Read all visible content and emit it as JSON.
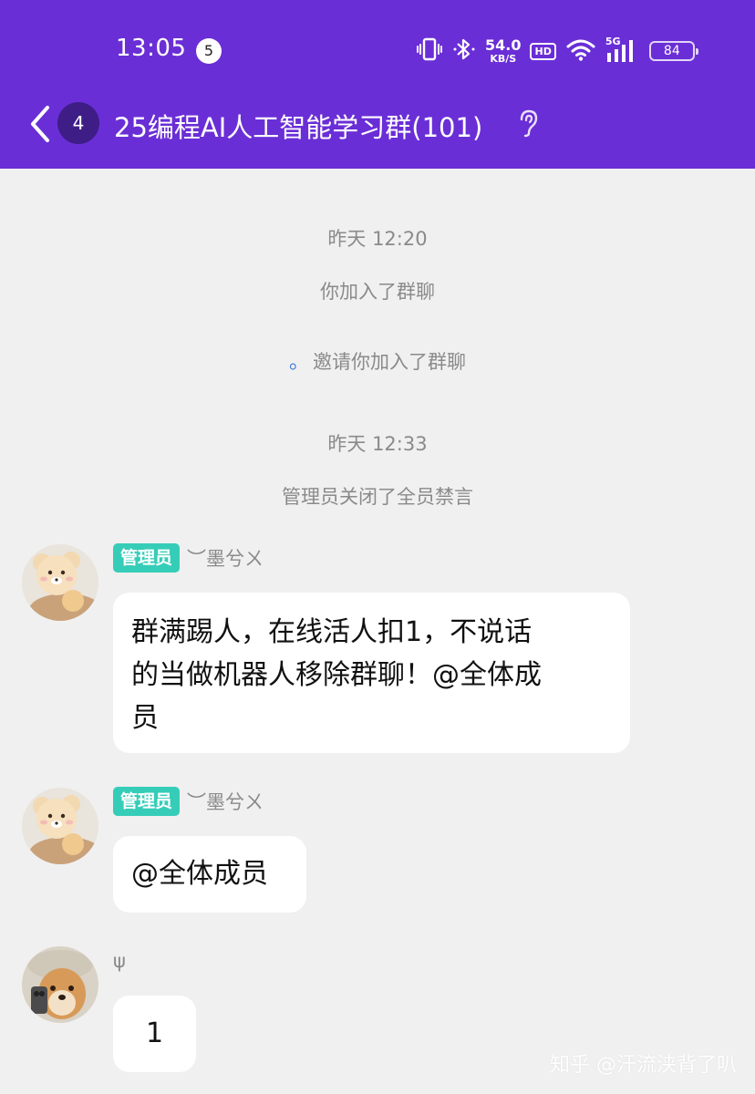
{
  "status_bar": {
    "time": "13:05",
    "notification_count": "5",
    "net_speed_value": "54.0",
    "net_speed_unit": "KB/S",
    "hd_label": "HD",
    "network_label": "5G",
    "battery_level": "84"
  },
  "header": {
    "unread_count": "4",
    "title": "25编程AI人工智能学习群(101)",
    "icons": {
      "back": "chevron-left-icon",
      "earpiece": "ear-icon"
    },
    "background_color": "#6a2ed6"
  },
  "system_messages": [
    {
      "text": "昨天 12:20"
    },
    {
      "text": "你加入了群聊"
    },
    {
      "prefix": "。",
      "text": "邀请你加入了群聊"
    },
    {
      "text": "昨天 12:33"
    },
    {
      "text": "管理员关闭了全员禁言"
    }
  ],
  "messages": [
    {
      "role": "管理员",
      "sender": "︶墨兮ㄨ",
      "lines": [
        "群满踢人，在线活人扣1，不说话",
        "的当做机器人移除群聊！@全体成",
        "员"
      ]
    },
    {
      "role": "管理员",
      "sender": "︶墨兮ㄨ",
      "lines": [
        "@全体成员"
      ]
    },
    {
      "role": "",
      "sender": "ψ",
      "lines": [
        "1"
      ]
    }
  ],
  "watermark": "知乎 @汗流浃背了叭",
  "colors": {
    "chat_background": "#f0f0f0",
    "bubble": "#ffffff",
    "role_badge": "#36cdb8",
    "system_text": "#8a8a8a"
  }
}
